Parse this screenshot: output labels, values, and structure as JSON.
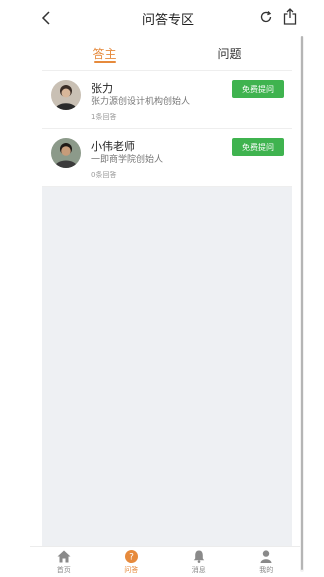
{
  "header": {
    "title": "问答专区",
    "back_icon": "chevron-left-icon",
    "refresh_icon": "refresh-icon",
    "share_icon": "share-icon"
  },
  "tabs": [
    {
      "label": "答主",
      "active": true
    },
    {
      "label": "问题",
      "active": false
    }
  ],
  "answerers": [
    {
      "name": "张力",
      "desc": "张力源创设计机构创始人",
      "count": "1条回答",
      "button": "免费提问"
    },
    {
      "name": "小伟老师",
      "desc": "一即商学院创始人",
      "count": "0条回答",
      "button": "免费提问"
    }
  ],
  "tabbar": [
    {
      "label": "首页",
      "icon": "home-icon",
      "active": false
    },
    {
      "label": "问答",
      "icon": "question-icon",
      "active": true
    },
    {
      "label": "消息",
      "icon": "bell-icon",
      "active": false
    },
    {
      "label": "我的",
      "icon": "user-icon",
      "active": false
    }
  ],
  "colors": {
    "accent": "#e68a3c",
    "button": "#3fb34f",
    "background": "#eef0f3"
  }
}
